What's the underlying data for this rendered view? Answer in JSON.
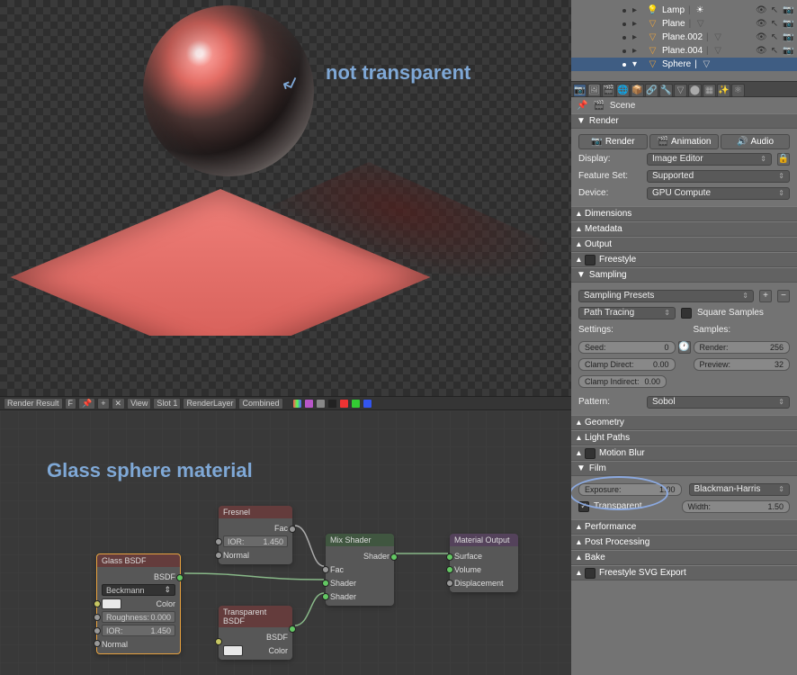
{
  "viewport": {
    "annotation_text": "not transparent",
    "material_title": "Glass sphere material"
  },
  "image_toolbar": {
    "slot_f": "F",
    "view": "View",
    "slot": "Slot 1",
    "layer": "RenderLayer",
    "pass": "Combined",
    "image_name": "Render Result"
  },
  "nodes": {
    "glass": {
      "title": "Glass BSDF",
      "out": "BSDF",
      "distribution": "Beckmann",
      "color_label": "Color",
      "roughness_label": "Roughness:",
      "roughness": "0.000",
      "ior_label": "IOR:",
      "ior": "1.450",
      "normal": "Normal"
    },
    "fresnel": {
      "title": "Fresnel",
      "out": "Fac",
      "ior_label": "IOR:",
      "ior": "1.450",
      "normal": "Normal"
    },
    "transparent": {
      "title": "Transparent BSDF",
      "out": "BSDF",
      "color_label": "Color"
    },
    "mix": {
      "title": "Mix Shader",
      "out": "Shader",
      "fac": "Fac",
      "in1": "Shader",
      "in2": "Shader"
    },
    "output": {
      "title": "Material Output",
      "surface": "Surface",
      "volume": "Volume",
      "displacement": "Displacement"
    }
  },
  "outliner": {
    "items": [
      {
        "name": "Lamp",
        "expandable": true
      },
      {
        "name": "Plane",
        "expandable": true
      },
      {
        "name": "Plane.002",
        "expandable": true
      },
      {
        "name": "Plane.004",
        "expandable": true
      },
      {
        "name": "Sphere",
        "expandable": true,
        "open": true
      }
    ]
  },
  "breadcrumb": {
    "scene": "Scene"
  },
  "render": {
    "header": "Render",
    "render_btn": "Render",
    "anim_btn": "Animation",
    "audio_btn": "Audio",
    "display_label": "Display:",
    "display": "Image Editor",
    "feature_label": "Feature Set:",
    "feature": "Supported",
    "device_label": "Device:",
    "device": "GPU Compute"
  },
  "panels": {
    "dimensions": "Dimensions",
    "metadata": "Metadata",
    "output": "Output",
    "freestyle": "Freestyle",
    "sampling": "Sampling",
    "geometry": "Geometry",
    "light_paths": "Light Paths",
    "motion_blur": "Motion Blur",
    "film": "Film",
    "performance": "Performance",
    "post_processing": "Post Processing",
    "bake": "Bake",
    "freestyle_svg": "Freestyle SVG Export"
  },
  "sampling": {
    "presets": "Sampling Presets",
    "integrator": "Path Tracing",
    "square": "Square Samples",
    "settings_label": "Settings:",
    "samples_label": "Samples:",
    "seed_label": "Seed:",
    "seed": "0",
    "clamp_direct_label": "Clamp Direct:",
    "clamp_direct": "0.00",
    "clamp_indirect_label": "Clamp Indirect:",
    "clamp_indirect": "0.00",
    "render_label": "Render:",
    "render": "256",
    "preview_label": "Preview:",
    "preview": "32",
    "pattern_label": "Pattern:",
    "pattern": "Sobol"
  },
  "film": {
    "exposure_label": "Exposure:",
    "exposure": "1.00",
    "transparent": "Transparent",
    "filter": "Blackman-Harris",
    "width_label": "Width:",
    "width": "1.50"
  }
}
